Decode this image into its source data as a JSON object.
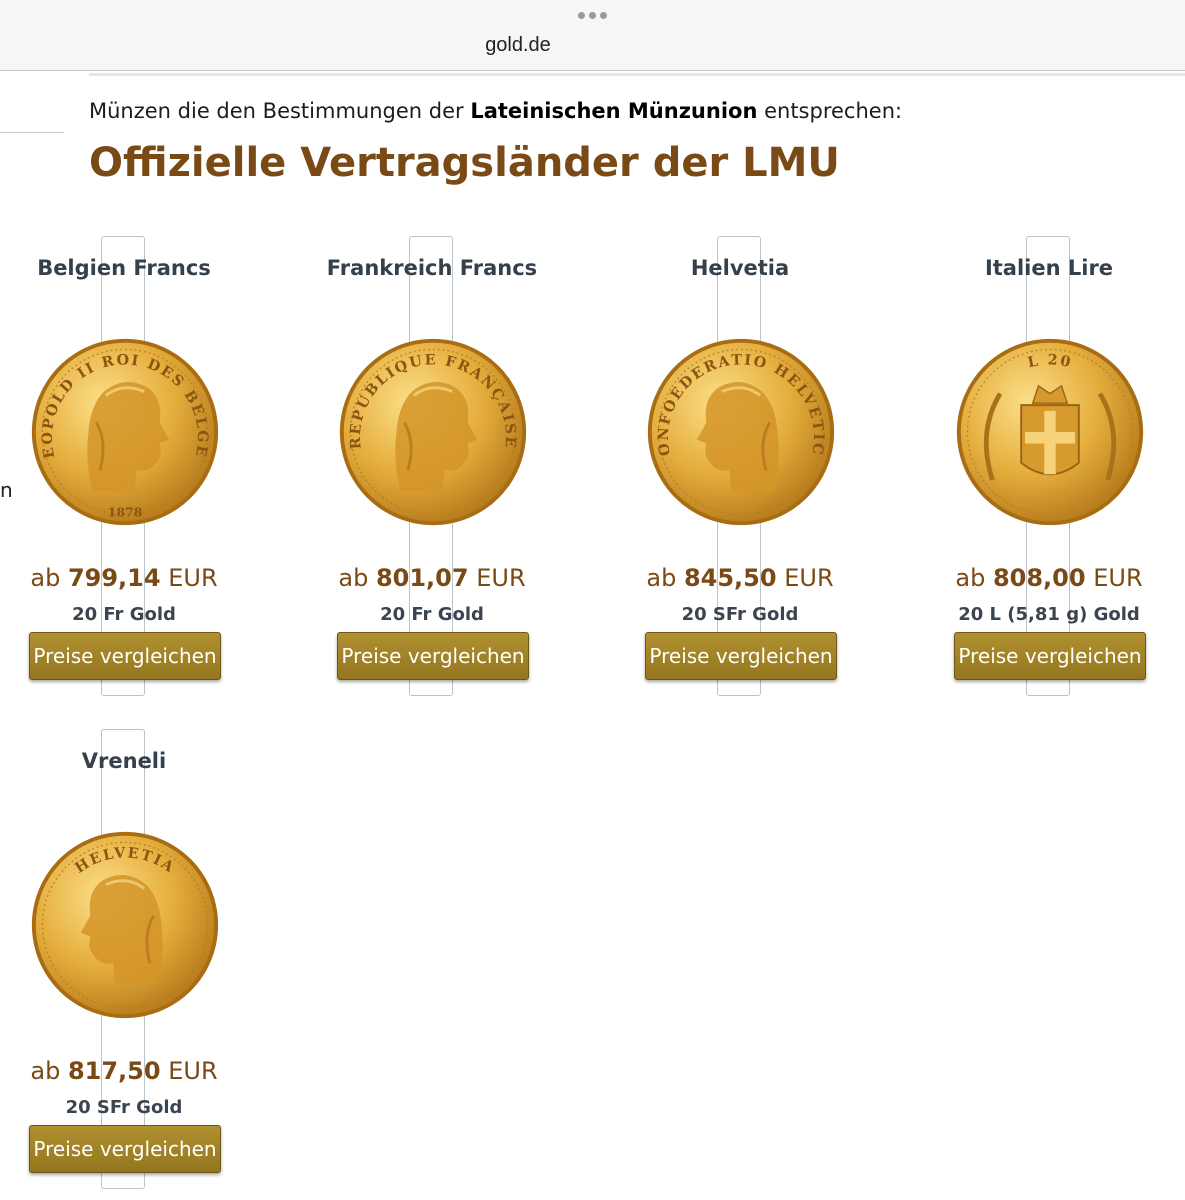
{
  "browser": {
    "url": "gold.de"
  },
  "page": {
    "left_cut_text": "n",
    "intro_prefix": "Münzen die den Bestimmungen der ",
    "intro_bold": "Lateinischen Münzunion",
    "intro_suffix": " entsprechen:",
    "heading": "Offizielle Vertragsländer der LMU"
  },
  "colors": {
    "heading": "#7a4a16",
    "button": "#9c7d25",
    "gold_light": "#fbe08a",
    "gold_dark": "#b4781a"
  },
  "products": [
    {
      "name": "Belgien Francs",
      "price_prefix": "ab ",
      "price_value": "799,14",
      "currency": " EUR",
      "spec": "20 Fr Gold",
      "button": "Preise vergleichen",
      "coin_text": "LEOPOLD II   ROI DES BELGES",
      "coin_year": "1878",
      "coin_icon": "belgium-coin-icon"
    },
    {
      "name": "Frankreich Francs",
      "price_prefix": "ab ",
      "price_value": "801,07",
      "currency": " EUR",
      "spec": "20 Fr Gold",
      "button": "Preise vergleichen",
      "coin_text": "REPUBLIQUE   FRANÇAISE",
      "coin_year": "",
      "coin_icon": "france-coin-icon"
    },
    {
      "name": "Helvetia",
      "price_prefix": "ab ",
      "price_value": "845,50",
      "currency": " EUR",
      "spec": "20 SFr Gold",
      "button": "Preise vergleichen",
      "coin_text": "CONFOEDERATIO   HELVETICA",
      "coin_year": "",
      "coin_icon": "helvetia-coin-icon"
    },
    {
      "name": "Italien Lire",
      "price_prefix": "ab ",
      "price_value": "808,00",
      "currency": " EUR",
      "spec": "20 L (5,81 g) Gold",
      "button": "Preise vergleichen",
      "coin_text": "L  20",
      "coin_year": "",
      "coin_icon": "italy-coin-icon"
    },
    {
      "name": "Vreneli",
      "price_prefix": "ab ",
      "price_value": "817,50",
      "currency": " EUR",
      "spec": "20 SFr Gold",
      "button": "Preise vergleichen",
      "coin_text": "HELVETIA",
      "coin_year": "",
      "coin_icon": "vreneli-coin-icon"
    }
  ]
}
